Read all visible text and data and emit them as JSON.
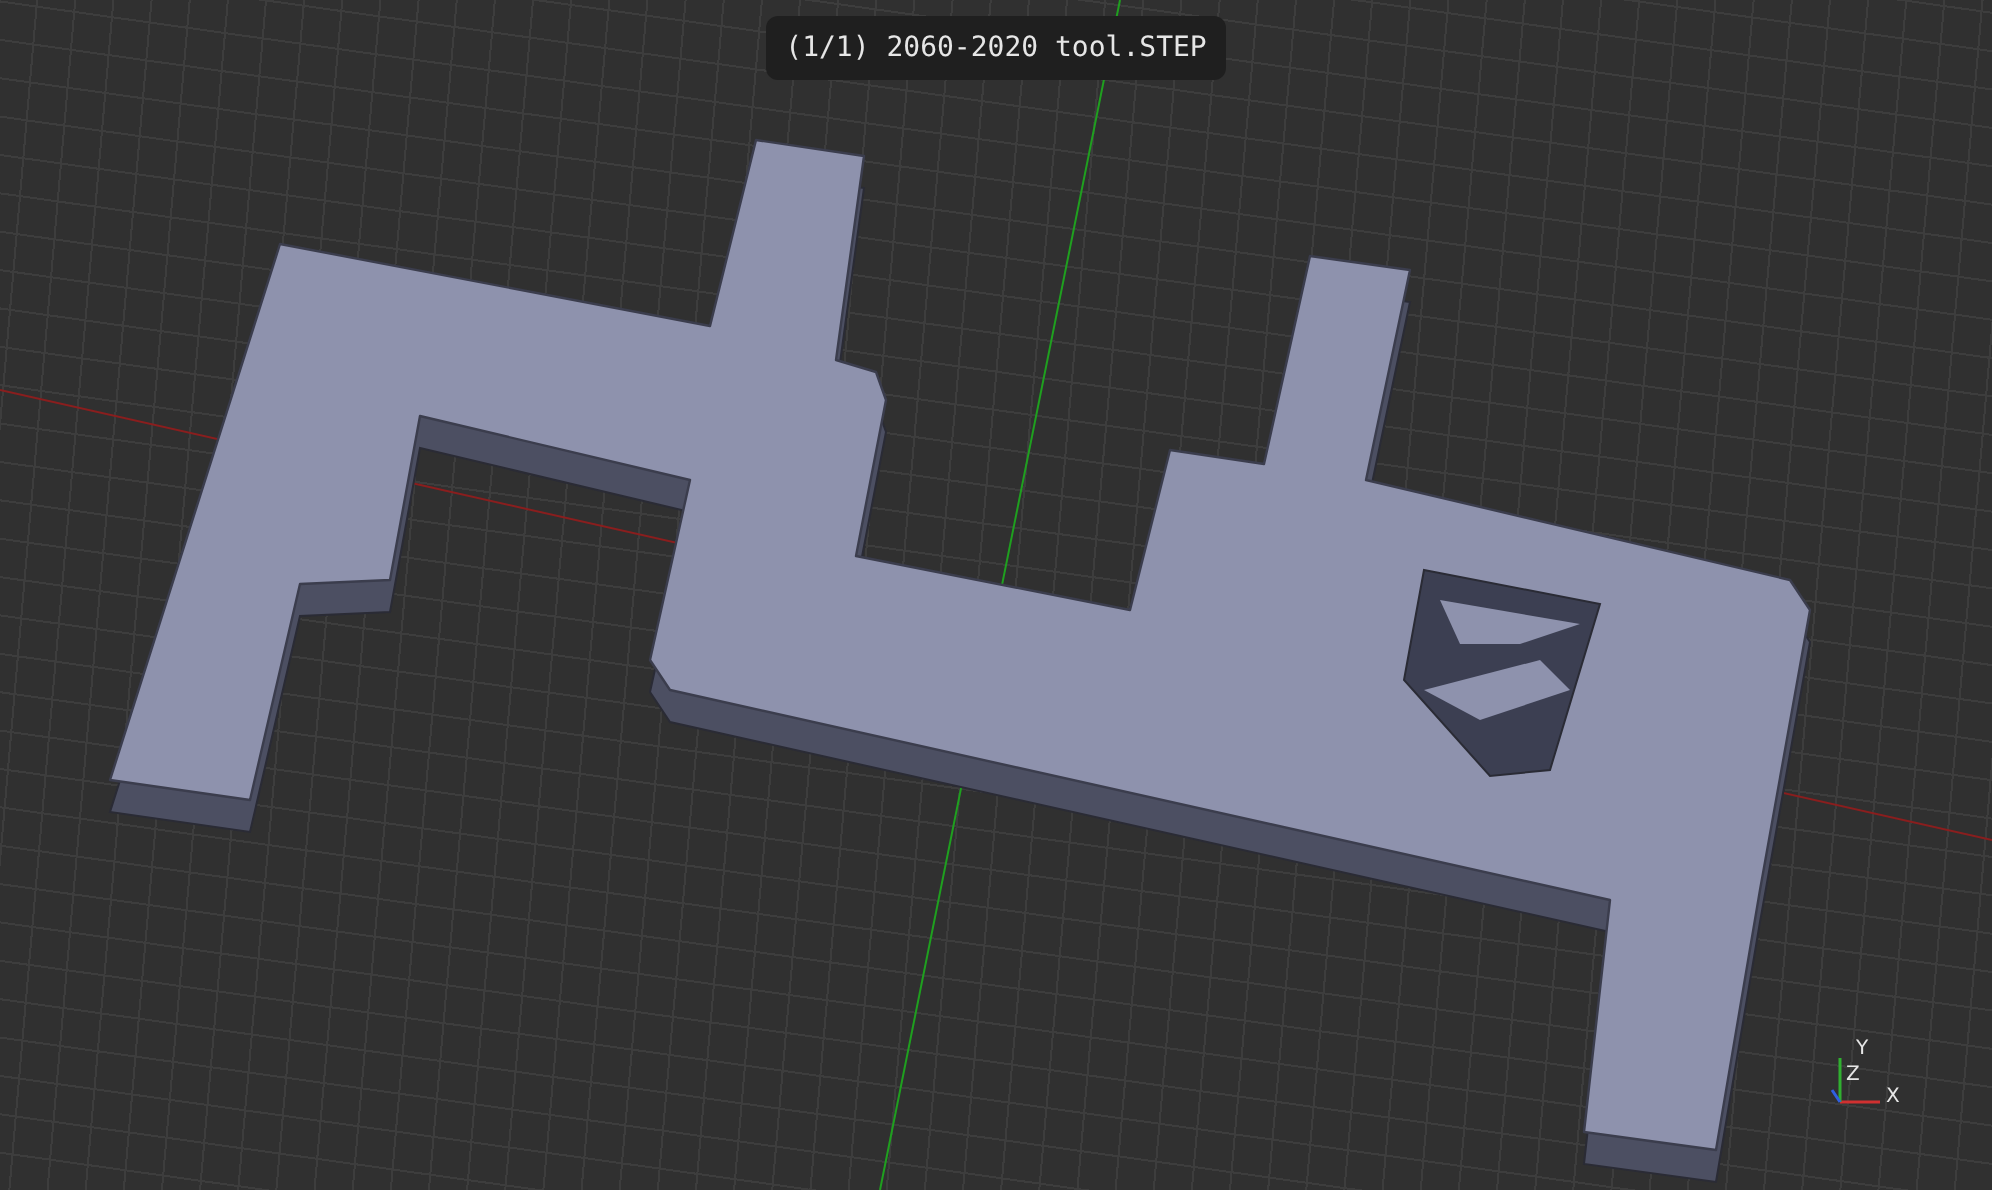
{
  "viewer": {
    "title": "(1/1) 2060-2020 tool.STEP"
  },
  "axis_triad": {
    "labels": [
      "Y",
      "Z",
      "X"
    ]
  }
}
